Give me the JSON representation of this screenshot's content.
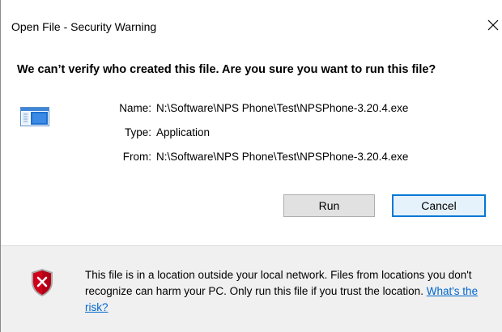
{
  "window": {
    "title": "Open File - Security Warning",
    "close_glyph": "✕"
  },
  "main": {
    "question": "We can’t verify who created this file. Are you sure you want to run this file?",
    "file_icon": "application-file-icon",
    "details": [
      {
        "key": "Name:",
        "value": "N:\\Software\\NPS Phone\\Test\\NPSPhone-3.20.4.exe"
      },
      {
        "key": "Type:",
        "value": "Application"
      },
      {
        "key": "From:",
        "value": "N:\\Software\\NPS Phone\\Test\\NPSPhone-3.20.4.exe"
      }
    ],
    "buttons": {
      "run": "Run",
      "cancel": "Cancel"
    }
  },
  "footer": {
    "icon": "security-shield-icon",
    "warning_text": "This file is in a location outside your local network. Files from locations you don't recognize can harm your PC. Only run this file if you trust the location.",
    "link_text": "What's the risk?"
  },
  "colors": {
    "accent": "#0078d7",
    "link": "#0066cc",
    "footer_bg": "#f0f0f0",
    "shield_red": "#d0021b"
  }
}
